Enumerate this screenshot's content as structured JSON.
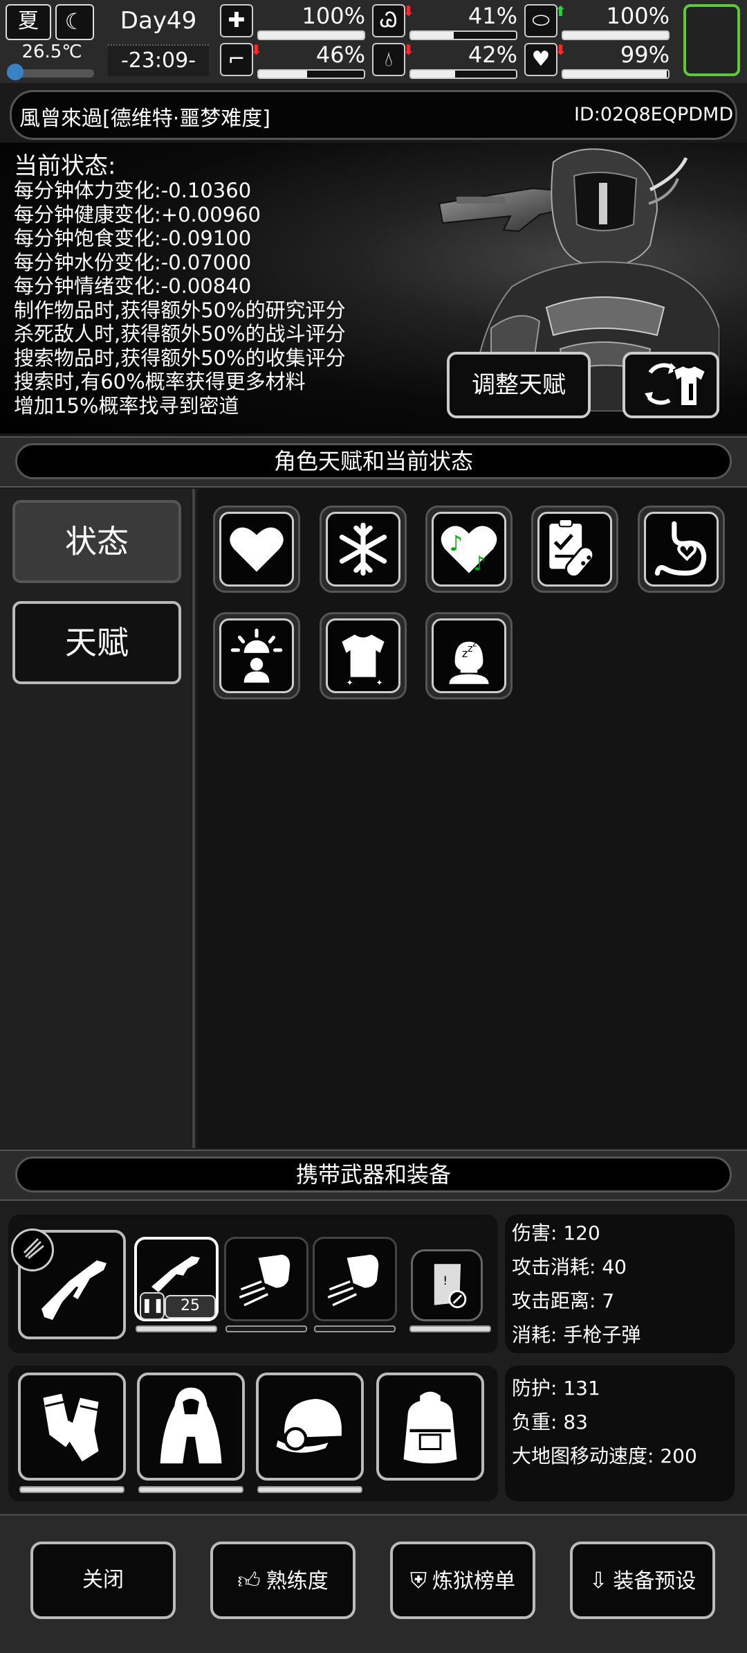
{
  "status_bar": {
    "season": "夏",
    "temperature": "26.5℃",
    "temperature_level": 0.1,
    "day": "Day49",
    "clock": "-23:09-",
    "stats": [
      {
        "name": "health",
        "icon": "medkit-icon",
        "value": "100%",
        "level": 1.0,
        "trend": ""
      },
      {
        "name": "hunger",
        "icon": "stomach-icon",
        "value": "41%",
        "level": 0.41,
        "trend": "down"
      },
      {
        "name": "medicine",
        "icon": "pill-icon",
        "value": "100%",
        "level": 1.0,
        "trend": "up"
      },
      {
        "name": "stamina",
        "icon": "boot-icon",
        "value": "46%",
        "level": 0.46,
        "trend": "down"
      },
      {
        "name": "water",
        "icon": "water-drop-icon",
        "value": "42%",
        "level": 0.42,
        "trend": "down"
      },
      {
        "name": "mood",
        "icon": "heart-hand-icon",
        "value": "99%",
        "level": 0.99,
        "trend": "down"
      }
    ],
    "colors": {
      "temp_blue": "#3b82c4",
      "up_green": "#2ecc40",
      "down_red": "#ff2a2a",
      "highlight_green": "#5cc83a"
    }
  },
  "character": {
    "name": "風曾來過[德维特·噩梦难度]",
    "id": "ID:02Q8EQPDMD",
    "status_title": "当前状态:",
    "status_lines": [
      "每分钟体力变化:-0.10360",
      "每分钟健康变化:+0.00960",
      "每分钟饱食变化:-0.09100",
      "每分钟水份变化:-0.07000",
      "每分钟情绪变化:-0.00840",
      "制作物品时,获得额外50%的研究评分",
      "杀死敌人时,获得额外50%的战斗评分",
      "搜索物品时,获得额外50%的收集评分",
      "搜索时,有60%概率获得更多材料",
      "增加15%概率找寻到密道"
    ],
    "adjust_talent_label": "调整天赋"
  },
  "talent_section": {
    "title": "角色天赋和当前状态",
    "tabs": [
      {
        "label": "状态",
        "active": true
      },
      {
        "label": "天赋",
        "active": false
      }
    ],
    "status_icons": [
      "heart-icon",
      "snowflake-icon",
      "music-heart-icon",
      "medical-report-icon",
      "stomach-heart-icon",
      "alarm-person-icon",
      "shirt-icon",
      "sleeping-person-icon"
    ]
  },
  "equipment_section": {
    "title": "携带武器和装备",
    "weapon_slots": [
      {
        "icon": "smg-icon",
        "badge": "",
        "durability": 1.0
      },
      {
        "icon": "smg-icon",
        "badge": "25",
        "durability": 1.0
      },
      {
        "icon": "fist-icon",
        "badge": "",
        "durability": 0
      },
      {
        "icon": "fist-icon",
        "badge": "",
        "durability": 0
      },
      {
        "icon": "map-icon",
        "badge": "",
        "durability": 1.0
      }
    ],
    "weapon_stats": [
      {
        "label": "伤害",
        "value": "120"
      },
      {
        "label": "攻击消耗",
        "value": "40"
      },
      {
        "label": "攻击距离",
        "value": "7"
      },
      {
        "label": "消耗",
        "value": "手枪子弹"
      }
    ],
    "armor_slots": [
      {
        "icon": "gloves-icon",
        "durability": 1.0
      },
      {
        "icon": "cloak-icon",
        "durability": 1.0
      },
      {
        "icon": "cap-icon",
        "durability": 1.0
      },
      {
        "icon": "backpack-icon",
        "durability": null
      }
    ],
    "armor_stats": [
      {
        "label": "防护",
        "value": "131"
      },
      {
        "label": "负重",
        "value": "83"
      },
      {
        "label": "大地图移动速度",
        "value": "200"
      }
    ]
  },
  "bottom_buttons": [
    {
      "label": "关闭",
      "icon": ""
    },
    {
      "label": "熟练度",
      "icon": "thumbs-up-badge-icon"
    },
    {
      "label": "炼狱榜单",
      "icon": "banner-icon"
    },
    {
      "label": "装备预设",
      "icon": "download-box-icon"
    }
  ]
}
